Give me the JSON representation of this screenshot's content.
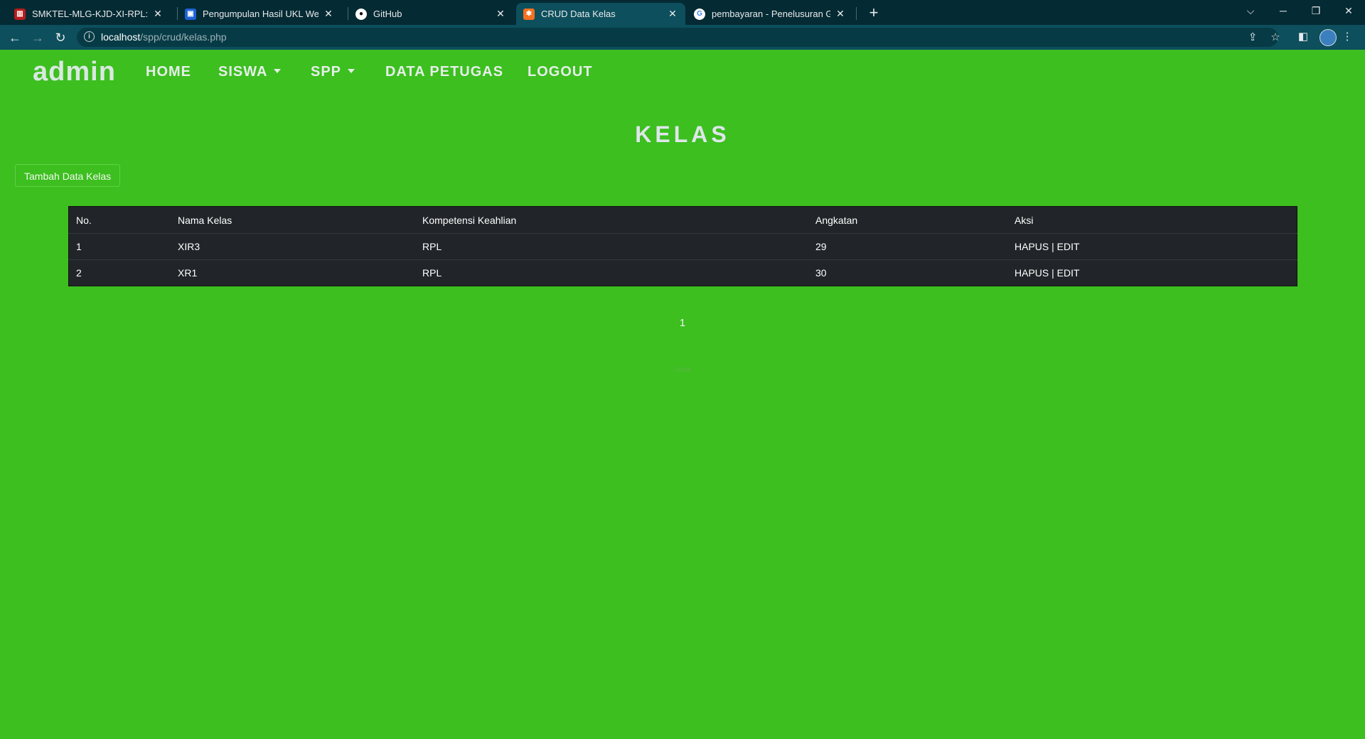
{
  "browser": {
    "tabs": [
      {
        "title": "SMKTEL-MLG-KJD-XI-RPL: Modu",
        "favicon": "book-icon",
        "active": false
      },
      {
        "title": "Pengumpulan Hasil UKL Web",
        "favicon": "classroom-icon",
        "active": false
      },
      {
        "title": "GitHub",
        "favicon": "github-icon",
        "active": false
      },
      {
        "title": "CRUD Data Kelas",
        "favicon": "xampp-icon",
        "active": true
      },
      {
        "title": "pembayaran - Penelusuran Goog",
        "favicon": "google-icon",
        "active": false
      }
    ],
    "url_host": "localhost",
    "url_path": "/spp/crud/kelas.php"
  },
  "navbar": {
    "brand": "admin",
    "links": [
      "HOME",
      "SISWA",
      "SPP",
      "DATA PETUGAS",
      "LOGOUT"
    ]
  },
  "page": {
    "title": "KELAS",
    "add_button": "Tambah Data Kelas"
  },
  "table": {
    "headers": [
      "No.",
      "Nama Kelas",
      "Kompetensi Keahlian",
      "Angkatan",
      "Aksi"
    ],
    "rows": [
      {
        "no": "1",
        "nama": "XIR3",
        "kompetensi": "RPL",
        "angkatan": "29",
        "hapus": "HAPUS",
        "sep": "|",
        "edit": "EDIT"
      },
      {
        "no": "2",
        "nama": "XR1",
        "kompetensi": "RPL",
        "angkatan": "30",
        "hapus": "HAPUS",
        "sep": "|",
        "edit": "EDIT"
      }
    ]
  },
  "pagination": {
    "current": "1"
  },
  "footer": {
    "text": "ucrkk"
  }
}
